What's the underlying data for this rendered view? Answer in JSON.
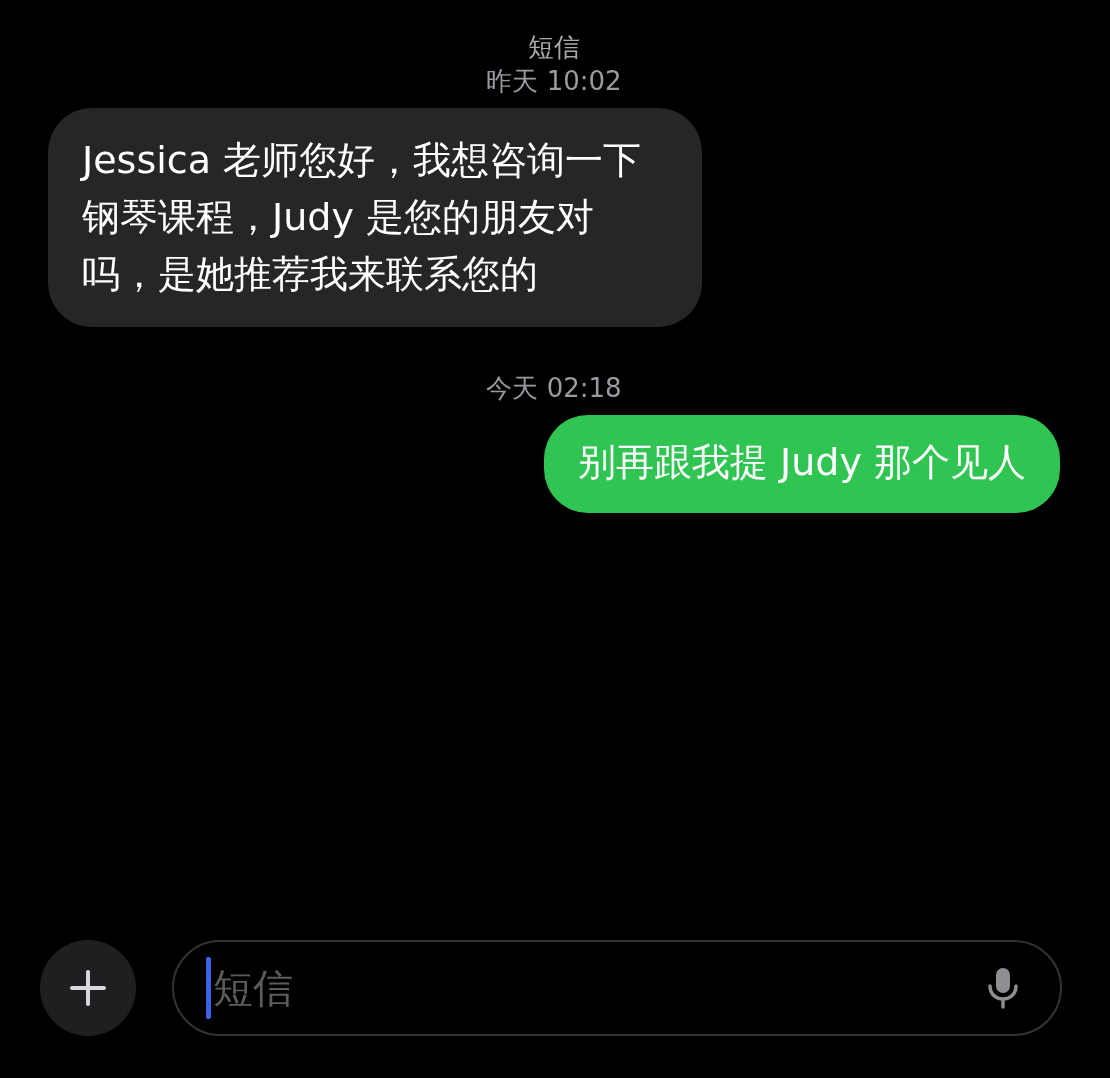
{
  "conversation": {
    "title": "短信"
  },
  "items": [
    {
      "kind": "timestamp",
      "text": "昨天 10:02"
    },
    {
      "kind": "incoming",
      "text": "Jessica 老师您好，我想咨询一下钢琴课程，Judy 是您的朋友对吗，是她推荐我来联系您的"
    },
    {
      "kind": "timestamp",
      "text": "今天 02:18"
    },
    {
      "kind": "outgoing",
      "text": "别再跟我提 Judy 那个见人"
    }
  ],
  "composer": {
    "placeholder": "短信"
  }
}
